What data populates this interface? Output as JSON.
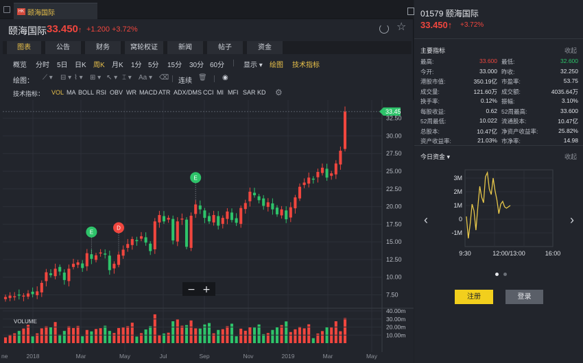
{
  "tab": {
    "badge": "HK",
    "label": "颐海国际"
  },
  "quote": {
    "name": "颐海国际",
    "price": "33.450",
    "arrow": "↑",
    "change": "+1.200 +3.72%"
  },
  "nav_tabs": [
    {
      "label": "图表",
      "active": true
    },
    {
      "label": "公告",
      "active": false
    },
    {
      "label": "财务",
      "active": false
    },
    {
      "label": "窝轮权证",
      "active": false
    },
    {
      "label": "新闻",
      "active": false
    },
    {
      "label": "帖子",
      "active": false
    },
    {
      "label": "资金",
      "active": false
    }
  ],
  "periods": [
    {
      "label": "概览",
      "active": false
    },
    {
      "label": "分时",
      "active": false
    },
    {
      "label": "5日",
      "active": false
    },
    {
      "label": "日K",
      "active": false
    },
    {
      "label": "周K",
      "active": true
    },
    {
      "label": "月K",
      "active": false
    },
    {
      "label": "1分",
      "active": false
    },
    {
      "label": "5分",
      "active": false
    },
    {
      "label": "15分",
      "active": false
    },
    {
      "label": "30分",
      "active": false
    },
    {
      "label": "60分",
      "active": false
    }
  ],
  "display_menu": "显示",
  "draw_toggle": "绘图",
  "tech_toggle": "技术指标",
  "draw_row": {
    "label": "绘图：",
    "continuous": "连续"
  },
  "indicator_row": {
    "label": "技术指标：",
    "items": [
      {
        "label": "VOL",
        "active": true
      },
      {
        "label": "MA",
        "active": false
      },
      {
        "label": "BOLL",
        "active": false
      },
      {
        "label": "RSI",
        "active": false
      },
      {
        "label": "OBV",
        "active": false
      },
      {
        "label": "WR",
        "active": false
      },
      {
        "label": "MACD",
        "active": false
      },
      {
        "label": "ATR",
        "active": false
      },
      {
        "label": "ADX/DMS",
        "active": false
      },
      {
        "label": "CCI",
        "active": false
      },
      {
        "label": "MI",
        "active": false
      },
      {
        "label": "MFI",
        "active": false
      },
      {
        "label": "SAR",
        "active": false
      },
      {
        "label": "KD",
        "active": false
      }
    ]
  },
  "chart_data": {
    "type": "candlestick",
    "interval": "weekly",
    "price_axis": {
      "min": 6.0,
      "max": 34.5,
      "ticks": [
        "7.50",
        "10.00",
        "12.50",
        "15.00",
        "17.50",
        "20.00",
        "22.50",
        "25.00",
        "27.50",
        "30.00",
        "32.50"
      ]
    },
    "current_price_tag": "33.45",
    "x_axis_labels": [
      "ne",
      "2018",
      "Mar",
      "May",
      "Jul",
      "Sep",
      "Nov",
      "2019",
      "Mar",
      "May"
    ],
    "candles_close": [
      7.2,
      7.4,
      7.3,
      7.5,
      7.4,
      7.7,
      7.6,
      8.0,
      9.2,
      10.7,
      10.3,
      11.2,
      10.8,
      9.6,
      11.2,
      11.9,
      12.1,
      11.3,
      13.4,
      12.6,
      13.1,
      13.5,
      13.2,
      11.0,
      11.9,
      13.2,
      13.9,
      14.7,
      15.4,
      15.2,
      15.8,
      14.9,
      13.7,
      17.9,
      18.8,
      17.9,
      18.4,
      15.2,
      17.9,
      18.3,
      14.3,
      18.7,
      20.3,
      19.6,
      18.4,
      17.9,
      18.8,
      17.3,
      18.4,
      19.3,
      18.1,
      17.7,
      19.8,
      20.5,
      22.1,
      21.6,
      20.9,
      20.1,
      20.6,
      19.6,
      18.9,
      19.6,
      18.2,
      19.9,
      21.3,
      22.8,
      23.4,
      24.1,
      23.9,
      24.9,
      25.5,
      24.1,
      24.7,
      26.1,
      27.9,
      33.45
    ],
    "volume_axis": {
      "ticks": [
        "10.00m",
        "20.00m",
        "30.00m",
        "40.00m"
      ],
      "title": "VOLUME"
    },
    "event_markers": [
      {
        "label": "E",
        "type": "earnings"
      },
      {
        "label": "D",
        "type": "dividend"
      },
      {
        "label": "E",
        "type": "earnings"
      }
    ]
  },
  "zoom_controls": {
    "minus": "−",
    "plus": "+"
  },
  "right_panel": {
    "title": "01579 颐海国际",
    "price": "33.450↑",
    "change": "+3.72%",
    "metrics_section": {
      "label": "主要指标",
      "collapse": "收起"
    },
    "metrics": [
      [
        "最高:",
        "33.600",
        "最低:",
        "32.600"
      ],
      [
        "今开:",
        "33.000",
        "昨收:",
        "32.250"
      ],
      [
        "港股市值:",
        "350.19亿",
        "市盈率:",
        "53.75"
      ],
      [
        "成交量:",
        "121.60万",
        "成交额:",
        "4035.64万"
      ],
      [
        "换手率:",
        "0.12%",
        "振幅:",
        "3.10%"
      ],
      [
        "每股收益:",
        "0.62",
        "52周最高:",
        "33.600"
      ],
      [
        "52周最低:",
        "10.022",
        "流通股本:",
        "10.47亿"
      ],
      [
        "总股本:",
        "10.47亿",
        "净资产收益率:",
        "25.82%"
      ],
      [
        "资产收益率:",
        "21.03%",
        "市净率:",
        "14.98"
      ]
    ],
    "flow_section": {
      "label": "今日资金 ▾",
      "collapse": "收起"
    },
    "flow_chart": {
      "y_ticks": [
        "3M",
        "2M",
        "1M",
        "0",
        "-1M"
      ],
      "x_ticks": [
        "9:30",
        "12:00/13:00",
        "16:00"
      ],
      "line_color": "#e8c84a"
    },
    "buttons": {
      "register": "注册",
      "login": "登录"
    }
  }
}
